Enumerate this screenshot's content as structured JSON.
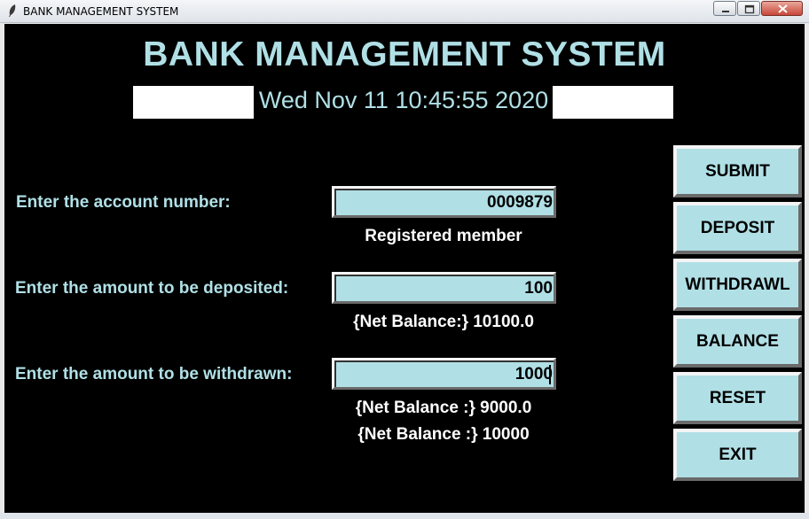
{
  "window": {
    "title": "BANK MANAGEMENT SYSTEM",
    "controls": {
      "minimize": "minimize-icon",
      "maximize": "maximize-icon",
      "close": "close-icon"
    }
  },
  "header": {
    "title": "BANK MANAGEMENT SYSTEM",
    "clock": "Wed Nov 11 10:45:55 2020"
  },
  "form": {
    "account_label": "Enter the account number:",
    "account_value": "0009879",
    "account_status": "Registered member",
    "deposit_label": "Enter the amount to be deposited:",
    "deposit_value": "100",
    "deposit_status": "{Net Balance:} 10100.0",
    "withdraw_label": "Enter the amount to be withdrawn:",
    "withdraw_value": "1000",
    "withdraw_status": "{Net Balance :} 9000.0",
    "balance_status": "{Net Balance :} 10000"
  },
  "buttons": {
    "submit": "SUBMIT",
    "deposit": "DEPOSIT",
    "withdraw": "WITHDRAWL",
    "balance": "BALANCE",
    "reset": "RESET",
    "exit": "EXIT"
  },
  "colors": {
    "accent": "#b0e0e6",
    "background": "#000000",
    "status_text": "#ffffff"
  }
}
